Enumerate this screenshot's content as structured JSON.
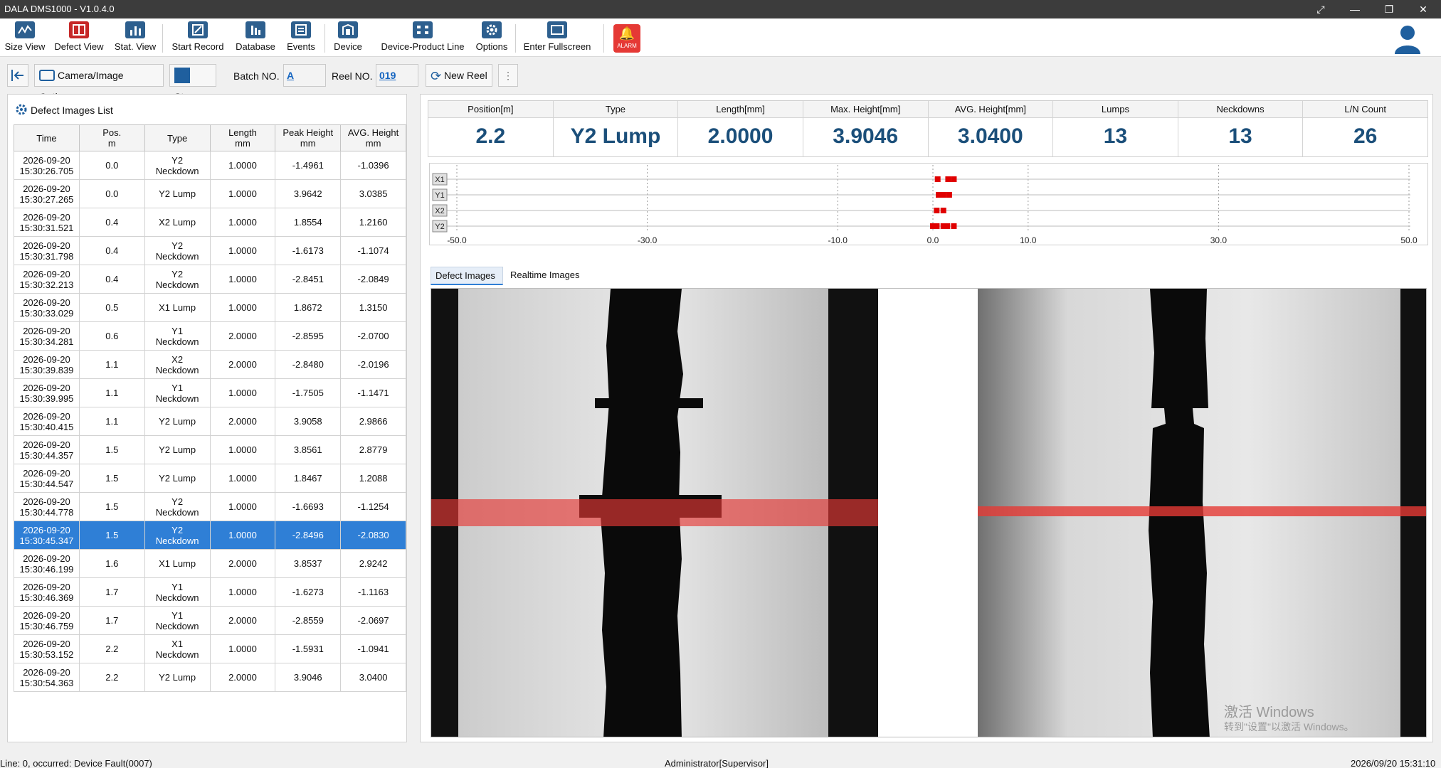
{
  "app": {
    "title": "DALA DMS1000 - V1.0.4.0"
  },
  "toolbar": {
    "items": [
      {
        "label": "Size View",
        "icon": "wave-chart-icon"
      },
      {
        "label": "Defect View",
        "icon": "defect-view-icon"
      },
      {
        "label": "Stat. View",
        "icon": "bar-chart-icon"
      },
      {
        "label": "Start Record",
        "icon": "record-icon"
      },
      {
        "label": "Database",
        "icon": "database-icon"
      },
      {
        "label": "Events",
        "icon": "events-icon"
      },
      {
        "label": "Device",
        "icon": "device-icon"
      },
      {
        "label": "Device-Product Line",
        "icon": "product-line-icon"
      },
      {
        "label": "Options",
        "icon": "gear-icon"
      },
      {
        "label": "Enter Fullscreen",
        "icon": "fullscreen-icon"
      }
    ],
    "alarm_label": "ALARM"
  },
  "controls": {
    "camera_options": "Camera/Image Options",
    "stop": "Stop",
    "batch_label": "Batch NO.",
    "batch_value": "A",
    "reel_label": "Reel NO.",
    "reel_value": "019",
    "new_reel": "New Reel"
  },
  "defects_list": {
    "title": "Defect Images List",
    "columns": [
      [
        "Time"
      ],
      [
        "Pos.",
        "m"
      ],
      [
        "Type"
      ],
      [
        "Length",
        "mm"
      ],
      [
        "Peak Height",
        "mm"
      ],
      [
        "AVG. Height",
        "mm"
      ]
    ],
    "rows": [
      {
        "date": "2026-09-20",
        "time": "15:30:26.705",
        "pos": "0.0",
        "type": "Y2 Neckdown",
        "length": "1.0000",
        "peak": "-1.4961",
        "avg": "-1.0396"
      },
      {
        "date": "2026-09-20",
        "time": "15:30:27.265",
        "pos": "0.0",
        "type": "Y2 Lump",
        "length": "1.0000",
        "peak": "3.9642",
        "avg": "3.0385"
      },
      {
        "date": "2026-09-20",
        "time": "15:30:31.521",
        "pos": "0.4",
        "type": "X2 Lump",
        "length": "1.0000",
        "peak": "1.8554",
        "avg": "1.2160"
      },
      {
        "date": "2026-09-20",
        "time": "15:30:31.798",
        "pos": "0.4",
        "type": "Y2 Neckdown",
        "length": "1.0000",
        "peak": "-1.6173",
        "avg": "-1.1074"
      },
      {
        "date": "2026-09-20",
        "time": "15:30:32.213",
        "pos": "0.4",
        "type": "Y2 Neckdown",
        "length": "1.0000",
        "peak": "-2.8451",
        "avg": "-2.0849"
      },
      {
        "date": "2026-09-20",
        "time": "15:30:33.029",
        "pos": "0.5",
        "type": "X1 Lump",
        "length": "1.0000",
        "peak": "1.8672",
        "avg": "1.3150"
      },
      {
        "date": "2026-09-20",
        "time": "15:30:34.281",
        "pos": "0.6",
        "type": "Y1 Neckdown",
        "length": "2.0000",
        "peak": "-2.8595",
        "avg": "-2.0700"
      },
      {
        "date": "2026-09-20",
        "time": "15:30:39.839",
        "pos": "1.1",
        "type": "X2 Neckdown",
        "length": "2.0000",
        "peak": "-2.8480",
        "avg": "-2.0196"
      },
      {
        "date": "2026-09-20",
        "time": "15:30:39.995",
        "pos": "1.1",
        "type": "Y1 Neckdown",
        "length": "1.0000",
        "peak": "-1.7505",
        "avg": "-1.1471"
      },
      {
        "date": "2026-09-20",
        "time": "15:30:40.415",
        "pos": "1.1",
        "type": "Y2 Lump",
        "length": "2.0000",
        "peak": "3.9058",
        "avg": "2.9866"
      },
      {
        "date": "2026-09-20",
        "time": "15:30:44.357",
        "pos": "1.5",
        "type": "Y2 Lump",
        "length": "1.0000",
        "peak": "3.8561",
        "avg": "2.8779"
      },
      {
        "date": "2026-09-20",
        "time": "15:30:44.547",
        "pos": "1.5",
        "type": "Y2 Lump",
        "length": "1.0000",
        "peak": "1.8467",
        "avg": "1.2088"
      },
      {
        "date": "2026-09-20",
        "time": "15:30:44.778",
        "pos": "1.5",
        "type": "Y2 Neckdown",
        "length": "1.0000",
        "peak": "-1.6693",
        "avg": "-1.1254"
      },
      {
        "date": "2026-09-20",
        "time": "15:30:45.347",
        "pos": "1.5",
        "type": "Y2 Neckdown",
        "length": "1.0000",
        "peak": "-2.8496",
        "avg": "-2.0830",
        "selected": true
      },
      {
        "date": "2026-09-20",
        "time": "15:30:46.199",
        "pos": "1.6",
        "type": "X1 Lump",
        "length": "2.0000",
        "peak": "3.8537",
        "avg": "2.9242"
      },
      {
        "date": "2026-09-20",
        "time": "15:30:46.369",
        "pos": "1.7",
        "type": "Y1 Neckdown",
        "length": "1.0000",
        "peak": "-1.6273",
        "avg": "-1.1163"
      },
      {
        "date": "2026-09-20",
        "time": "15:30:46.759",
        "pos": "1.7",
        "type": "Y1 Neckdown",
        "length": "2.0000",
        "peak": "-2.8559",
        "avg": "-2.0697"
      },
      {
        "date": "2026-09-20",
        "time": "15:30:53.152",
        "pos": "2.2",
        "type": "X1 Neckdown",
        "length": "1.0000",
        "peak": "-1.5931",
        "avg": "-1.0941"
      },
      {
        "date": "2026-09-20",
        "time": "15:30:54.363",
        "pos": "2.2",
        "type": "Y2 Lump",
        "length": "2.0000",
        "peak": "3.9046",
        "avg": "3.0400"
      }
    ]
  },
  "summary": [
    {
      "label": "Position[m]",
      "value": "2.2"
    },
    {
      "label": "Type",
      "value": "Y2 Lump"
    },
    {
      "label": "Length[mm]",
      "value": "2.0000"
    },
    {
      "label": "Max. Height[mm]",
      "value": "3.9046"
    },
    {
      "label": "AVG. Height[mm]",
      "value": "3.0400"
    },
    {
      "label": "Lumps",
      "value": "13"
    },
    {
      "label": "Neckdowns",
      "value": "13"
    },
    {
      "label": "L/N Count",
      "value": "26"
    }
  ],
  "defect_map": {
    "lanes": [
      "X1",
      "Y1",
      "X2",
      "Y2"
    ],
    "ticks": [
      "-50.0",
      "-30.0",
      "-10.0",
      "0.0",
      "10.0",
      "30.0",
      "50.0"
    ],
    "xlim": [
      -50,
      50
    ],
    "marker_color": "#e00000"
  },
  "image_tabs": [
    "Defect Images",
    "Realtime Images"
  ],
  "watermark": {
    "line1": "激活 Windows",
    "line2": "转到\"设置\"以激活 Windows。"
  },
  "status": {
    "left": "Line: 0, occurred: Device Fault(0007)",
    "center": "Administrator[Supervisor]",
    "right": "2026/09/20 15:31:10"
  },
  "colors": {
    "selection": "#2f7fd6",
    "value_text": "#1b4f7a",
    "highlight": "#e53935"
  }
}
